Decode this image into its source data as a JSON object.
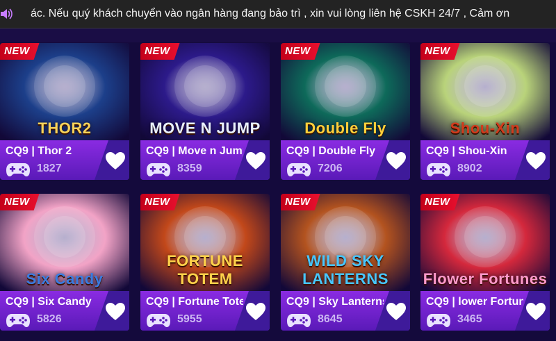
{
  "announcement": {
    "speaker_icon": "speaker-icon",
    "text": "ác. Nếu quý khách chuyển vào ngân hàng đang bảo trì , xin vui lòng liên hệ CSKH 24/7 , Cảm ơn"
  },
  "games": [
    {
      "badge": "NEW",
      "logo": "THOR2",
      "provider": "CQ9",
      "name": "Thor 2",
      "plays": "1827",
      "bg": "#1c3f8a",
      "logo_color": "#f7d35a"
    },
    {
      "badge": "NEW",
      "logo": "MOVE N JUMP",
      "provider": "CQ9",
      "name": "Move n Jump",
      "plays": "8359",
      "bg": "#2c1a8a",
      "logo_color": "#e8f0ff"
    },
    {
      "badge": "NEW",
      "logo": "Double Fly",
      "provider": "CQ9",
      "name": "Double Fly",
      "plays": "7206",
      "bg": "#0e6a5a",
      "logo_color": "#ffcf3a"
    },
    {
      "badge": "NEW",
      "logo": "Shou-Xin",
      "provider": "CQ9",
      "name": "Shou-Xin",
      "plays": "8902",
      "bg": "#b9d37a",
      "logo_color": "#d33a1c"
    },
    {
      "badge": "NEW",
      "logo": "Six Candy",
      "provider": "CQ9",
      "name": "Six Candy",
      "plays": "5826",
      "bg": "#f2a3c6",
      "logo_color": "#3a7be0"
    },
    {
      "badge": "NEW",
      "logo": "FORTUNE TOTEM",
      "provider": "CQ9",
      "name": "Fortune Totem",
      "plays": "5955",
      "bg": "#c2481a",
      "logo_color": "#ffd24a"
    },
    {
      "badge": "NEW",
      "logo": "WILD SKY LANTERNS",
      "provider": "CQ9",
      "name": "Sky Lanterns",
      "plays": "8645",
      "bg": "#b3531f",
      "logo_color": "#46c6ff"
    },
    {
      "badge": "NEW",
      "logo": "Flower Fortunes",
      "provider": "CQ9",
      "name": "lower Fortunes",
      "plays": "3465",
      "bg": "#d4283c",
      "logo_color": "#ff9acb"
    }
  ],
  "icons": {
    "controller": "gamepad-icon",
    "favorite": "heart-icon",
    "badge": "new-badge"
  },
  "colors": {
    "page_bg": "#140a3c",
    "info_bar": "#8a2be2",
    "new_badge": "#e8102e",
    "count_text": "#cbb7f2"
  }
}
